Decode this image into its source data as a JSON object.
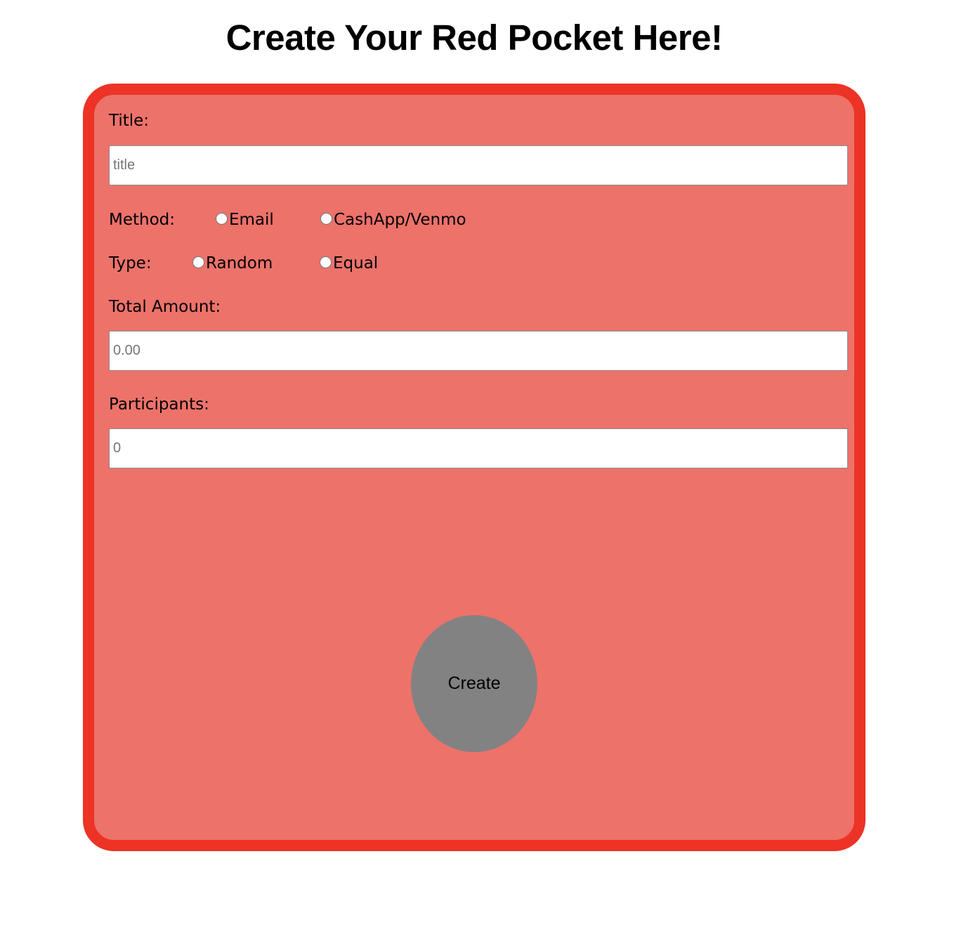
{
  "page": {
    "title": "Create Your Red Pocket Here!"
  },
  "form": {
    "title_label": "Title:",
    "title_input": {
      "placeholder": "title",
      "value": ""
    },
    "method_label": "Method:",
    "method_options": [
      "Email",
      "CashApp/Venmo"
    ],
    "type_label": "Type:",
    "type_options": [
      "Random",
      "Equal"
    ],
    "amount_label": "Total Amount:",
    "amount_input": {
      "placeholder": "0.00",
      "value": ""
    },
    "participants_label": "Participants:",
    "participants_input": {
      "placeholder": "0",
      "value": ""
    },
    "create_label": "Create"
  },
  "colors": {
    "card_border": "#ec3326",
    "card_background": "#ed726a",
    "button_background": "#828282"
  }
}
